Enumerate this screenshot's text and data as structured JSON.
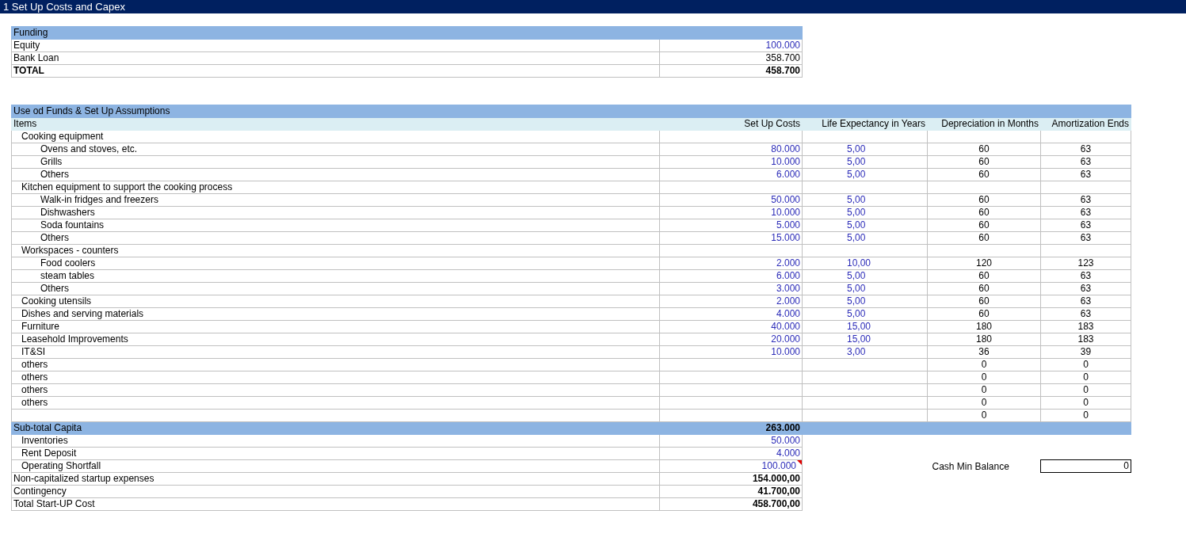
{
  "title_bar": {
    "text": "1 Set Up Costs and Capex"
  },
  "funding": {
    "header": "Funding",
    "rows": [
      {
        "label": "Equity",
        "value": "100.000",
        "kind": "input"
      },
      {
        "label": "Bank Loan",
        "value": "358.700",
        "kind": "calc"
      },
      {
        "label": "TOTAL",
        "value": "458.700",
        "kind": "total"
      }
    ]
  },
  "use_of_funds": {
    "header": "Use od Funds & Set Up Assumptions",
    "columns": [
      "Items",
      "Set Up Costs",
      "Life Expectancy in Years",
      "Depreciation in Months",
      "Amortization Ends"
    ],
    "items": [
      {
        "label": "Cooking equipment",
        "children": [
          {
            "label": "Ovens and stoves, etc.",
            "setup_cost": "80.000",
            "life_years": "5,00",
            "depreciation_months": "60",
            "amortization_ends": "63"
          },
          {
            "label": "Grills",
            "setup_cost": "10.000",
            "life_years": "5,00",
            "depreciation_months": "60",
            "amortization_ends": "63"
          },
          {
            "label": "Others",
            "setup_cost": "6.000",
            "life_years": "5,00",
            "depreciation_months": "60",
            "amortization_ends": "63"
          }
        ]
      },
      {
        "label": "Kitchen equipment to support the cooking process",
        "children": [
          {
            "label": "Walk-in fridges and freezers",
            "setup_cost": "50.000",
            "life_years": "5,00",
            "depreciation_months": "60",
            "amortization_ends": "63"
          },
          {
            "label": "Dishwashers",
            "setup_cost": "10.000",
            "life_years": "5,00",
            "depreciation_months": "60",
            "amortization_ends": "63"
          },
          {
            "label": "Soda fountains",
            "setup_cost": "5.000",
            "life_years": "5,00",
            "depreciation_months": "60",
            "amortization_ends": "63"
          },
          {
            "label": "Others",
            "setup_cost": "15.000",
            "life_years": "5,00",
            "depreciation_months": "60",
            "amortization_ends": "63"
          }
        ]
      },
      {
        "label": "Workspaces - counters",
        "children": [
          {
            "label": "Food coolers",
            "setup_cost": "2.000",
            "life_years": "10,00",
            "depreciation_months": "120",
            "amortization_ends": "123"
          },
          {
            "label": "steam tables",
            "setup_cost": "6.000",
            "life_years": "5,00",
            "depreciation_months": "60",
            "amortization_ends": "63"
          },
          {
            "label": "Others",
            "setup_cost": "3.000",
            "life_years": "5,00",
            "depreciation_months": "60",
            "amortization_ends": "63"
          }
        ]
      },
      {
        "label": "Cooking utensils",
        "setup_cost": "2.000",
        "life_years": "5,00",
        "depreciation_months": "60",
        "amortization_ends": "63"
      },
      {
        "label": "Dishes and serving materials",
        "setup_cost": "4.000",
        "life_years": "5,00",
        "depreciation_months": "60",
        "amortization_ends": "63"
      },
      {
        "label": "Furniture",
        "setup_cost": "40.000",
        "life_years": "15,00",
        "depreciation_months": "180",
        "amortization_ends": "183"
      },
      {
        "label": "Leasehold Improvements",
        "setup_cost": "20.000",
        "life_years": "15,00",
        "depreciation_months": "180",
        "amortization_ends": "183"
      },
      {
        "label": "IT&SI",
        "setup_cost": "10.000",
        "life_years": "3,00",
        "depreciation_months": "36",
        "amortization_ends": "39"
      },
      {
        "label": "others",
        "depreciation_months": "0",
        "amortization_ends": "0"
      },
      {
        "label": "others",
        "depreciation_months": "0",
        "amortization_ends": "0"
      },
      {
        "label": "others",
        "depreciation_months": "0",
        "amortization_ends": "0"
      },
      {
        "label": "others",
        "depreciation_months": "0",
        "amortization_ends": "0"
      },
      {
        "depreciation_months": "0",
        "amortization_ends": "0"
      }
    ]
  },
  "summary": {
    "rows": [
      {
        "label": "Sub-total Capita",
        "value": "263.000",
        "kind": "subtotal",
        "children": [
          {
            "label": "Inventories",
            "value": "50.000",
            "kind": "input"
          },
          {
            "label": "Rent Deposit",
            "value": "4.000",
            "kind": "input"
          },
          {
            "label": "Operating Shortfall",
            "value": "100.000",
            "kind": "input",
            "has_comment": true
          }
        ]
      },
      {
        "label": "Non-capitalized startup expenses",
        "value": "154.000,00",
        "kind": "total"
      },
      {
        "label": "Contingency",
        "value": "41.700,00",
        "kind": "total"
      },
      {
        "label": "Total Start-UP Cost",
        "value": "458.700,00",
        "kind": "total"
      }
    ]
  },
  "cash_min_balance": {
    "label": "Cash Min Balance",
    "value": "0"
  }
}
